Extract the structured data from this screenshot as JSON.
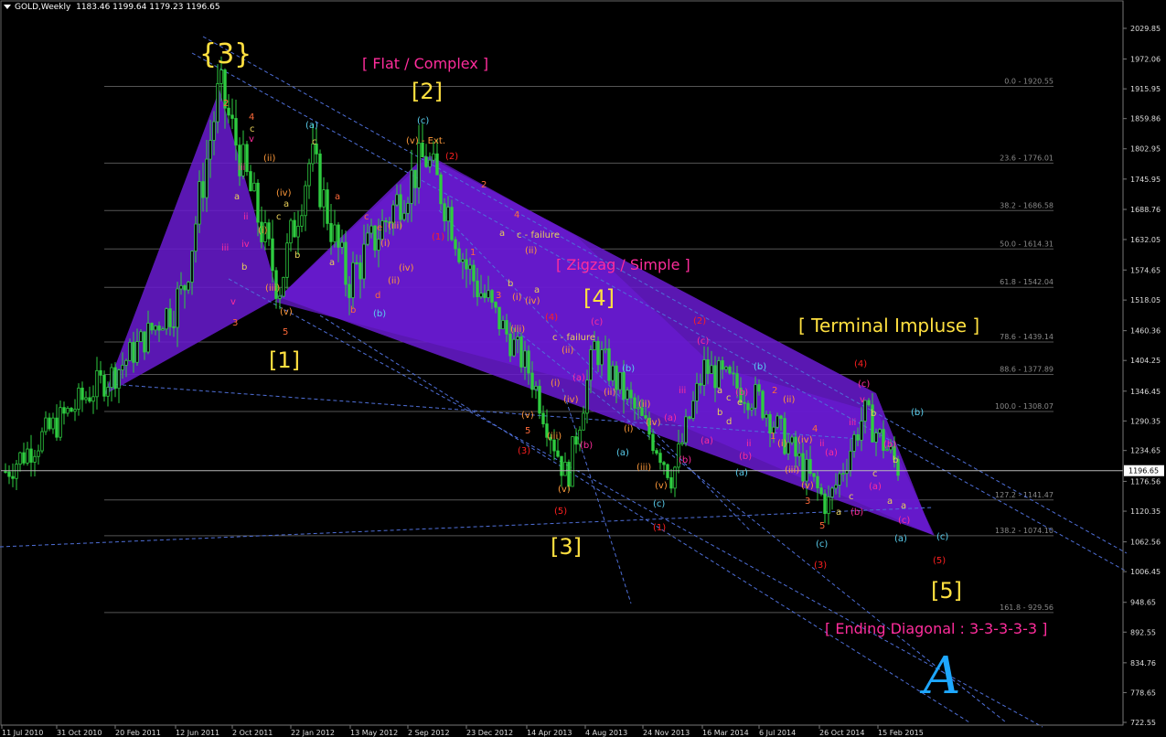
{
  "header": {
    "symbol": "GOLD,Weekly",
    "ohlc": "1183.46 1199.64 1179.23 1196.65"
  },
  "price_axis": {
    "labels": [
      "2029.85",
      "1972.06",
      "1915.95",
      "1859.86",
      "1802.95",
      "1745.95",
      "1688.76",
      "1632.05",
      "1574.65",
      "1518.05",
      "1460.36",
      "1404.25",
      "1346.45",
      "1290.35",
      "1234.65",
      "1176.56",
      "1120.35",
      "1062.56",
      "1006.45",
      "948.65",
      "892.55",
      "834.76",
      "778.65",
      "722.55"
    ],
    "current": "1196.65"
  },
  "time_axis": {
    "labels": [
      "11 Jul 2010",
      "31 Oct 2010",
      "20 Feb 2011",
      "12 Jun 2011",
      "2 Oct 2011",
      "22 Jan 2012",
      "13 May 2012",
      "2 Sep 2012",
      "23 Dec 2012",
      "14 Apr 2013",
      "4 Aug 2013",
      "24 Nov 2013",
      "16 Mar 2014",
      "6 Jul 2014",
      "26 Oct 2014",
      "15 Feb 2015"
    ]
  },
  "fib_levels": [
    {
      "label": "0.0 - 1920.55",
      "value": 1920.55
    },
    {
      "label": "23.6 - 1776.01",
      "value": 1776.01
    },
    {
      "label": "38.2 - 1686.58",
      "value": 1686.58
    },
    {
      "label": "50.0 - 1614.31",
      "value": 1614.31
    },
    {
      "label": "61.8 - 1542.04",
      "value": 1542.04
    },
    {
      "label": "78.6 - 1439.14",
      "value": 1439.14
    },
    {
      "label": "88.6 - 1377.89",
      "value": 1377.89
    },
    {
      "label": "100.0 - 1308.07",
      "value": 1308.07
    },
    {
      "label": "127.2 - 1141.47",
      "value": 1141.47
    },
    {
      "label": "138.2 - 1074.10",
      "value": 1074.1
    },
    {
      "label": "161.8 - 929.56",
      "value": 929.56
    }
  ],
  "annotations": {
    "flat_complex": "[ Flat / Complex ]",
    "zigzag_simple": "[ Zigzag / Simple ]",
    "terminal_impulse": "[ Terminal Impluse ]",
    "ending_diagonal": "[ Ending Diagonal : 3-3-3-3-3 ]",
    "w3_major": "{3}",
    "w1": "[1]",
    "w2": "[2]",
    "w3": "[3]",
    "w4": "[4]",
    "w5": "[5]",
    "ext": "(v) - Ext.",
    "failure1": "c - failure",
    "failure2": "c - failure",
    "logo": "A"
  },
  "colors": {
    "candle": "#2ecc40",
    "wedge": "#6a1bd1",
    "fib": "#555555",
    "trendline": "#4f6fd8",
    "yellow": "#ffe040",
    "magenta": "#ff2d9c",
    "red": "#ff2020",
    "cyan": "#5ad0f0",
    "orange": "#ff7a1a"
  },
  "chart_data": {
    "type": "candlestick",
    "title": "GOLD,Weekly",
    "x": [
      "2010-07",
      "2010-10",
      "2011-02",
      "2011-06",
      "2011-08",
      "2011-10",
      "2012-01",
      "2012-05",
      "2012-09",
      "2012-10",
      "2012-12",
      "2013-04",
      "2013-06",
      "2013-08",
      "2013-11",
      "2013-12",
      "2014-03",
      "2014-07",
      "2014-11",
      "2015-01",
      "2015-02"
    ],
    "series": [
      {
        "values": [
          1195,
          1355,
          1380,
          1530,
          1920,
          1540,
          1790,
          1550,
          1790,
          1690,
          1580,
          1380,
          1180,
          1430,
          1240,
          1185,
          1390,
          1330,
          1130,
          1305,
          1196
        ]
      }
    ],
    "ylim": [
      722.55,
      2029.85
    ],
    "grid": false
  }
}
